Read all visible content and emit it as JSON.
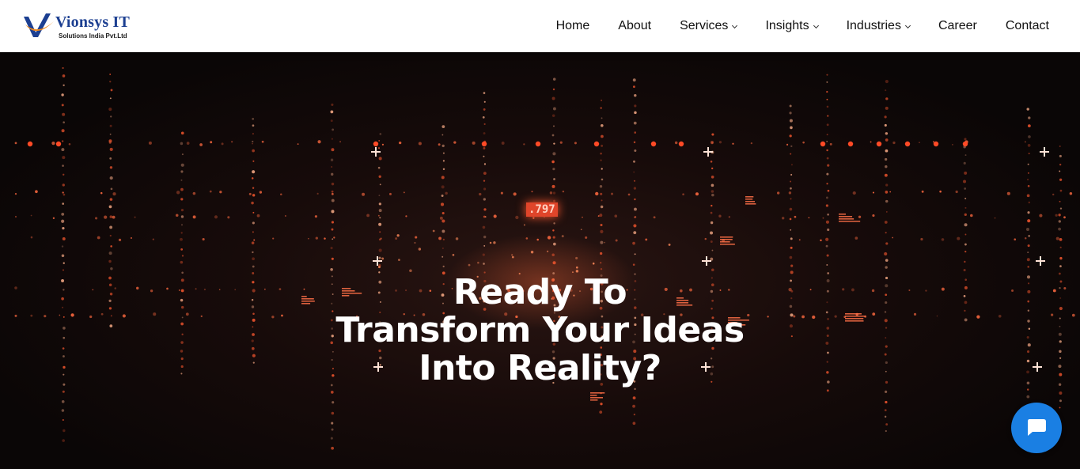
{
  "brand": {
    "name": "Vionsys IT",
    "subtitle": "Solutions India Pvt.Ltd"
  },
  "nav": {
    "items": [
      {
        "label": "Home",
        "dropdown": false
      },
      {
        "label": "About",
        "dropdown": false
      },
      {
        "label": "Services",
        "dropdown": true
      },
      {
        "label": "Insights",
        "dropdown": true
      },
      {
        "label": "Industries",
        "dropdown": true
      },
      {
        "label": "Career",
        "dropdown": false
      },
      {
        "label": "Contact",
        "dropdown": false
      }
    ]
  },
  "hero": {
    "headline_lines": [
      "Ready To",
      "Transform Your Ideas",
      "Into Reality?"
    ],
    "counter": ".797"
  },
  "chat": {
    "icon": "chat-bubble-icon"
  },
  "colors": {
    "accent_orange": "#ff5a30",
    "brand_blue": "#1c3f91",
    "chat_blue": "#1a7fe3"
  }
}
